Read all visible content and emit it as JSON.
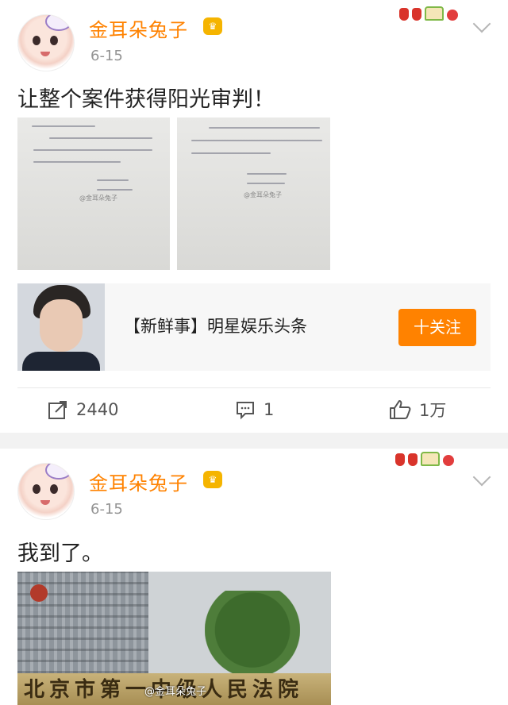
{
  "posts": [
    {
      "user": {
        "name": "金耳朵兔子",
        "badge": "♛"
      },
      "date": "6-15",
      "text": "让整个案件获得阳光审判！",
      "images": [
        {
          "caption": "申请人：",
          "watermark": "@金耳朵兔子"
        },
        {
          "caption": "申请人：",
          "watermark": "@金耳朵兔子"
        }
      ],
      "card": {
        "title": "【新鲜事】明星娱乐头条",
        "button": "十关注"
      },
      "actions": {
        "repost": "2440",
        "comment": "1",
        "like": "1万"
      }
    },
    {
      "user": {
        "name": "金耳朵兔子",
        "badge": "♛"
      },
      "date": "6-15",
      "text": "我到了。",
      "image": {
        "sign": "北京市第一中级人民法院",
        "watermark": "@金耳朵兔子"
      }
    }
  ],
  "colors": {
    "accent": "#ff8200",
    "date": "#939393",
    "separator": "#f2f2f2"
  }
}
